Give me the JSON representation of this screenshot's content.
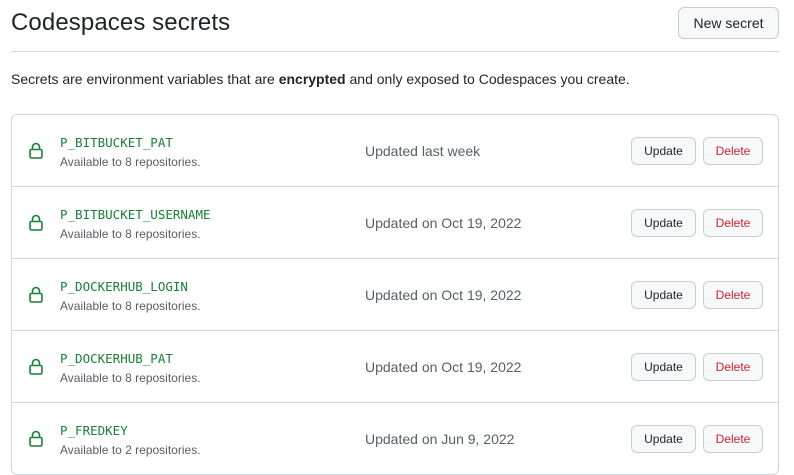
{
  "header": {
    "title": "Codespaces secrets",
    "new_secret_label": "New secret"
  },
  "description": {
    "prefix": "Secrets are environment variables that are ",
    "emphasis": "encrypted",
    "suffix": " and only exposed to Codespaces you create."
  },
  "colors": {
    "secret_name": "#1a7f37",
    "delete_text": "#cf222e",
    "lock_icon": "#1a7f37"
  },
  "secrets": [
    {
      "icon": "lock-icon",
      "name": "P_BITBUCKET_PAT",
      "availability": "Available to 8 repositories.",
      "updated": "Updated last week",
      "update_label": "Update",
      "delete_label": "Delete"
    },
    {
      "icon": "lock-icon",
      "name": "P_BITBUCKET_USERNAME",
      "availability": "Available to 8 repositories.",
      "updated": "Updated on Oct 19, 2022",
      "update_label": "Update",
      "delete_label": "Delete"
    },
    {
      "icon": "lock-icon",
      "name": "P_DOCKERHUB_LOGIN",
      "availability": "Available to 8 repositories.",
      "updated": "Updated on Oct 19, 2022",
      "update_label": "Update",
      "delete_label": "Delete"
    },
    {
      "icon": "lock-icon",
      "name": "P_DOCKERHUB_PAT",
      "availability": "Available to 8 repositories.",
      "updated": "Updated on Oct 19, 2022",
      "update_label": "Update",
      "delete_label": "Delete"
    },
    {
      "icon": "lock-icon",
      "name": "P_FREDKEY",
      "availability": "Available to 2 repositories.",
      "updated": "Updated on Jun 9, 2022",
      "update_label": "Update",
      "delete_label": "Delete"
    }
  ]
}
